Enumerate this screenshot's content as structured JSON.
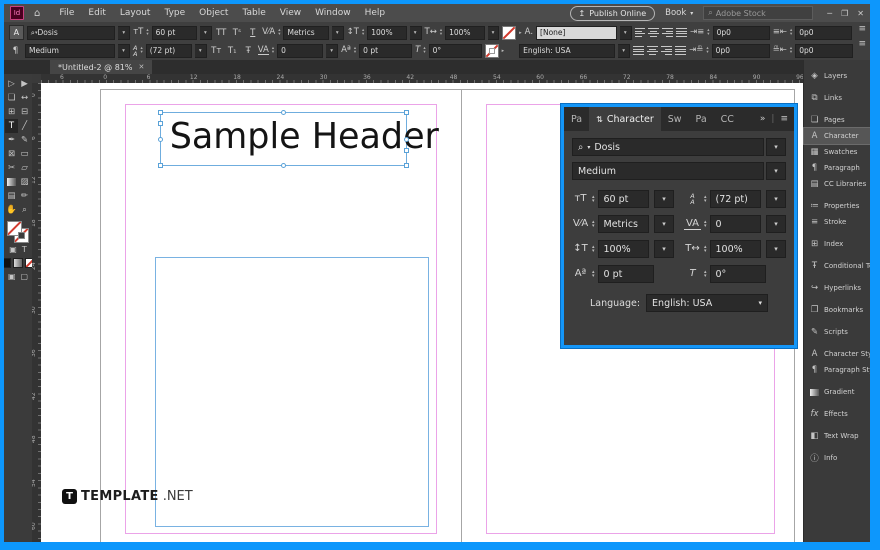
{
  "icons": {
    "search": "⌕",
    "chevron": "▾",
    "home": "⌂",
    "cloud_up": "↥",
    "overflow": "»",
    "menu": "≡",
    "close": "✕",
    "minimize": "─",
    "restore": "❐",
    "panel_stack": "⇅",
    "lightning": "ϟ",
    "tab_close": "✕",
    "caps": "TT",
    "superscript": "Tˢ",
    "underline": "T",
    "smallcaps": "Tт",
    "subscript": "T₁",
    "strike": "Ŧ",
    "size": "тT",
    "kern": "V⁄A",
    "track": "V̲A̲",
    "baseline": "Aª",
    "skew": "T",
    "charstyle": "A."
  },
  "menubar": {
    "logo": "Id",
    "items": [
      "File",
      "Edit",
      "Layout",
      "Type",
      "Object",
      "Table",
      "View",
      "Window",
      "Help"
    ],
    "publish_online": "Publish Online",
    "book": "Book",
    "search_placeholder": "Adobe Stock"
  },
  "control_panel": {
    "char_mode": "A",
    "para_mode": "¶",
    "font_family": "Dosis",
    "font_style": "Medium",
    "font_size": "60 pt",
    "leading": "(72 pt)",
    "kerning": "Metrics",
    "tracking": "0",
    "vertical_scale": "100%",
    "horizontal_scale": "100%",
    "baseline_shift": "0 pt",
    "skew": "0°",
    "character_style": "[None]",
    "language": "English: USA",
    "indent_left": "0p0",
    "indent_right": "0p0",
    "indent_first": "0p0",
    "indent_last": "0p0"
  },
  "document": {
    "tab_title": "*Untitled-2 @ 81%",
    "header_text": "Sample Header"
  },
  "ruler": {
    "h_labels": [
      "6",
      "0",
      "6",
      "12",
      "18",
      "24",
      "30",
      "36",
      "42",
      "48",
      "54",
      "60",
      "66",
      "72",
      "78",
      "84",
      "90",
      "96"
    ],
    "h_start": 19,
    "h_step": 43.3,
    "v_labels": [
      "0",
      "6",
      "12",
      "18",
      "24",
      "30",
      "36",
      "42",
      "48",
      "54",
      "60"
    ],
    "v_start": 8,
    "v_step": 43.3
  },
  "toolbar": {
    "tools": [
      {
        "name": "direct-selection-tool",
        "glyph": "▷"
      },
      {
        "name": "selection-tool",
        "glyph": "▶"
      },
      {
        "name": "page-tool",
        "glyph": "❏"
      },
      {
        "name": "gap-tool",
        "glyph": "↔"
      },
      {
        "name": "content-collector-tool",
        "glyph": "⊞"
      },
      {
        "name": "content-placer-tool",
        "glyph": "⊟"
      },
      {
        "name": "type-tool",
        "glyph": "T"
      },
      {
        "name": "line-tool",
        "glyph": "╱"
      },
      {
        "name": "pen-tool",
        "glyph": "✒"
      },
      {
        "name": "pencil-tool",
        "glyph": "✎"
      },
      {
        "name": "frame-tool",
        "glyph": "⊠"
      },
      {
        "name": "rectangle-tool",
        "glyph": "▭"
      },
      {
        "name": "scissors-tool",
        "glyph": "✂"
      },
      {
        "name": "free-transform-tool",
        "glyph": "▱"
      },
      {
        "name": "gradient-swatch-tool",
        "glyph": ""
      },
      {
        "name": "gradient-feather-tool",
        "glyph": "▨"
      },
      {
        "name": "note-tool",
        "glyph": "▤"
      },
      {
        "name": "eyedropper-tool",
        "glyph": "✏"
      },
      {
        "name": "hand-tool",
        "glyph": "✋"
      },
      {
        "name": "zoom-tool",
        "glyph": "⌕"
      }
    ],
    "container_text_toggle": [
      "▣",
      "T"
    ]
  },
  "character_panel": {
    "tabs": [
      "Pa",
      "Character",
      "Sw",
      "Pa",
      "CC"
    ],
    "font_family": "Dosis",
    "font_style": "Medium",
    "font_size": "60 pt",
    "leading": "(72 pt)",
    "kerning": "Metrics",
    "tracking": "0",
    "vertical_scale": "100%",
    "horizontal_scale": "100%",
    "baseline_shift": "0 pt",
    "skew": "0°",
    "language_label": "Language:",
    "language": "English: USA"
  },
  "dock": {
    "items": [
      {
        "icon": "◈",
        "label": "Layers"
      },
      {
        "icon": "⧉",
        "label": "Links"
      },
      {
        "icon": "❏",
        "label": "Pages"
      },
      {
        "icon": "A",
        "label": "Character"
      },
      {
        "icon": "▦",
        "label": "Swatches"
      },
      {
        "icon": "¶",
        "label": "Paragraph"
      },
      {
        "icon": "▤",
        "label": "CC Libraries"
      },
      {
        "icon": "≔",
        "label": "Properties"
      },
      {
        "icon": "≡",
        "label": "Stroke"
      },
      {
        "icon": "⊞",
        "label": "Index"
      },
      {
        "icon": "Ŧ",
        "label": "Conditional Text"
      },
      {
        "icon": "↪",
        "label": "Hyperlinks"
      },
      {
        "icon": "❐",
        "label": "Bookmarks"
      },
      {
        "icon": "✎",
        "label": "Scripts"
      },
      {
        "icon": "A",
        "label": "Character Styles"
      },
      {
        "icon": "¶",
        "label": "Paragraph Styles"
      },
      {
        "icon": "",
        "label": "Gradient"
      },
      {
        "icon": "fx",
        "label": "Effects"
      },
      {
        "icon": "◧",
        "label": "Text Wrap"
      },
      {
        "icon": "ⓘ",
        "label": "Info"
      }
    ]
  },
  "watermark": {
    "badge": "T",
    "brand": "TEMPLATE",
    "tld": ".NET"
  }
}
